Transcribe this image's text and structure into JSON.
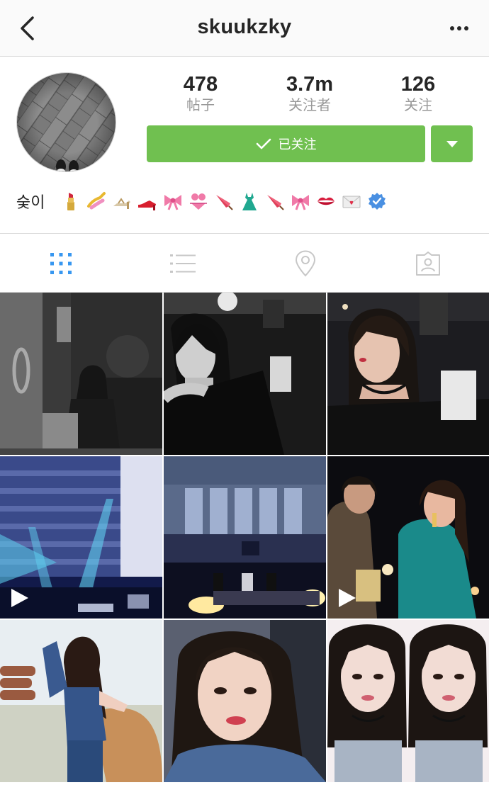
{
  "header": {
    "username": "skuukzky",
    "back_icon": "chevron-left-icon",
    "more_icon": "more-horizontal-icon"
  },
  "profile": {
    "stats": [
      {
        "value": "478",
        "label": "帖子"
      },
      {
        "value": "3.7m",
        "label": "关注者"
      },
      {
        "value": "126",
        "label": "关注"
      }
    ],
    "follow_button": {
      "label": "已关注",
      "icon": "checkmark-icon"
    },
    "dropdown_icon": "triangle-down-icon",
    "bio_name": "숮이",
    "bio_emojis": [
      "lipstick",
      "nail-polish",
      "sandal",
      "high-heel",
      "ribbon",
      "bikini",
      "closed-umbrella",
      "dress",
      "closed-umbrella",
      "ribbon",
      "kiss-mark",
      "love-letter",
      "verified-badge"
    ]
  },
  "tabs": [
    {
      "name": "grid-view",
      "icon": "grid-icon",
      "active": true
    },
    {
      "name": "list-view",
      "icon": "list-icon",
      "active": false
    },
    {
      "name": "location",
      "icon": "location-pin-icon",
      "active": false
    },
    {
      "name": "tagged",
      "icon": "tagged-person-icon",
      "active": false
    }
  ],
  "colors": {
    "accent_green": "#70c050",
    "active_tab_blue": "#3897f0",
    "inactive_icon": "#c7c7c7",
    "verified_blue": "#4a90e2"
  },
  "posts": [
    {
      "kind": "photo",
      "video": false
    },
    {
      "kind": "photo",
      "video": false
    },
    {
      "kind": "photo",
      "video": false
    },
    {
      "kind": "video",
      "video": true
    },
    {
      "kind": "photo",
      "video": false
    },
    {
      "kind": "video",
      "video": true
    },
    {
      "kind": "photo",
      "video": false
    },
    {
      "kind": "photo",
      "video": false
    },
    {
      "kind": "photo",
      "video": false
    }
  ]
}
